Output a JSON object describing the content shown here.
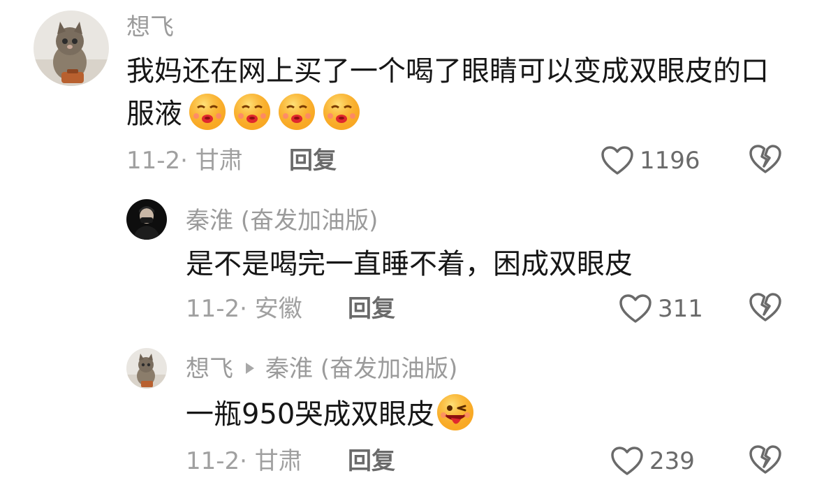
{
  "comments": [
    {
      "username": "想飞",
      "text": "我妈还在网上买了一个喝了眼睛可以变成双眼皮的口服液",
      "emoji": [
        "kiss-emoji",
        "kiss-emoji",
        "kiss-emoji",
        "kiss-emoji"
      ],
      "date_location": "11-2· 甘肃",
      "reply_label": "回复",
      "likes": "1196"
    },
    {
      "username": "秦淮 (奋发加油版)",
      "text": "是不是喝完一直睡不着，困成双眼皮",
      "emoji": [],
      "date_location": "11-2· 安徽",
      "reply_label": "回复",
      "likes": "311"
    },
    {
      "username": "想飞",
      "reply_to": "秦淮 (奋发加油版)",
      "text": "一瓶950哭成双眼皮",
      "emoji": [
        "wink-tongue-emoji"
      ],
      "date_location": "11-2· 甘肃",
      "reply_label": "回复",
      "likes": "239"
    }
  ]
}
